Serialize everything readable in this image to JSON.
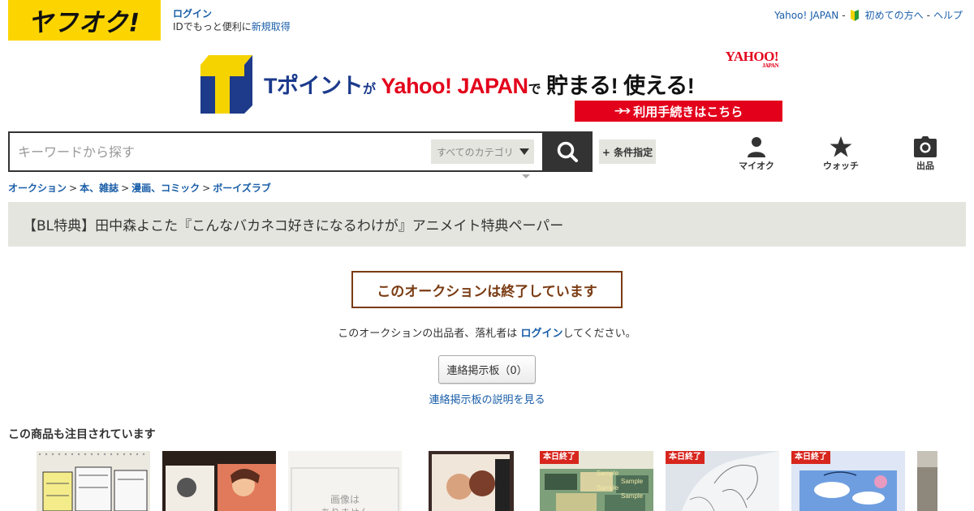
{
  "header": {
    "logo_text": "ヤフオク!",
    "login_label": "ログイン",
    "login_sub": "IDでもっと便利に",
    "register_label": "新規取得",
    "top_links": [
      "Yahoo! JAPAN",
      "初めての方へ",
      "ヘルプ"
    ],
    "link_sep": "-"
  },
  "banner": {
    "t_point": "Tポイント",
    "ga": "が",
    "yahoo_japan": "Yahoo! JAPAN",
    "de": "で",
    "tamaru": "貯まる! 使える!",
    "brand": "YAHOO!",
    "brand_small": "JAPAN",
    "cta": "利用手続きはこちら",
    "cta_arrows": "➔➔"
  },
  "search": {
    "placeholder": "キーワードから探す",
    "category": "すべてのカテゴリ",
    "conditions": "+ 条件指定"
  },
  "nav": [
    {
      "icon": "user-icon",
      "label": "マイオク"
    },
    {
      "icon": "star-icon",
      "label": "ウォッチ"
    },
    {
      "icon": "camera-icon",
      "label": "出品"
    }
  ],
  "breadcrumb": {
    "items": [
      "オークション",
      "本、雑誌",
      "漫画、コミック",
      "ボーイズラブ"
    ],
    "sep": ">"
  },
  "title": "【BL特典】田中森よこた『こんなバカネコ好きになるわけが』アニメイト特典ペーパー",
  "ended": {
    "message": "このオークションは終了しています",
    "note_before": "このオークションの出品者、落札者は ",
    "note_link": "ログイン",
    "note_after": "してください。",
    "board_button": "連絡掲示板（0）",
    "board_link": "連絡掲示板の説明を見る"
  },
  "recommend": {
    "heading": "この商品も注目されています",
    "badge": "本日終了",
    "noimage_text": "画像は\nありません",
    "items": [
      {
        "badge": false,
        "image": "manga-pages"
      },
      {
        "badge": false,
        "image": "bl-cover"
      },
      {
        "badge": false,
        "image": "no-image"
      },
      {
        "badge": false,
        "image": "bl-book-cover"
      },
      {
        "badge": true,
        "image": "sample-cards"
      },
      {
        "badge": true,
        "image": "sketch"
      },
      {
        "badge": true,
        "image": "sky-art"
      },
      {
        "badge": false,
        "image": "partial"
      }
    ]
  },
  "colors": {
    "logo_yellow": "#fcd500",
    "link_blue": "#1a5ea8",
    "ended_brown": "#7a3b12",
    "badge_red": "#d7261e",
    "title_bg": "#e5e5df"
  }
}
